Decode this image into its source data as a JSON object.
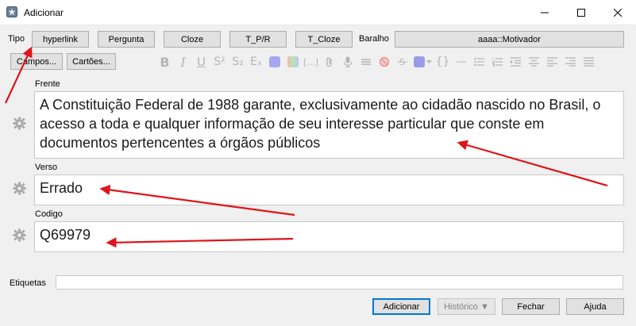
{
  "window": {
    "title": "Adicionar"
  },
  "toolbar": {
    "tipo_label": "Tipo",
    "note_types": [
      "hyperlink",
      "Pergunta",
      "Cloze",
      "T_P/R",
      "T_Cloze"
    ],
    "baralho_label": "Baralho",
    "deck": "aaaa::Motivador",
    "campos_button": "Campos...",
    "cartoes_button": "Cartões..."
  },
  "format_bar": {
    "bold": "B",
    "italic": "I",
    "underline": "U",
    "superscript": "S²",
    "subscript": "S₂",
    "clear": "Eₓ",
    "cloze": "[...]",
    "code": "{}",
    "color_swatch_1": "#a7a7ef",
    "color_swatch_2": "#9b9be8"
  },
  "fields": [
    {
      "label": "Frente",
      "value": "A Constituição Federal de 1988 garante, exclusivamente ao cidadão nascido no Brasil, o acesso a toda e qualquer informação de seu interesse particular que conste em documentos pertencentes a órgãos públicos"
    },
    {
      "label": "Verso",
      "value": "Errado"
    },
    {
      "label": "Codigo",
      "value": "Q69979"
    }
  ],
  "tags": {
    "label": "Etiquetas",
    "value": ""
  },
  "bottom_buttons": {
    "add": "Adicionar",
    "history": "Histórico ▼",
    "close": "Fechar",
    "help": "Ajuda"
  },
  "annotation_color": "#e0141b"
}
